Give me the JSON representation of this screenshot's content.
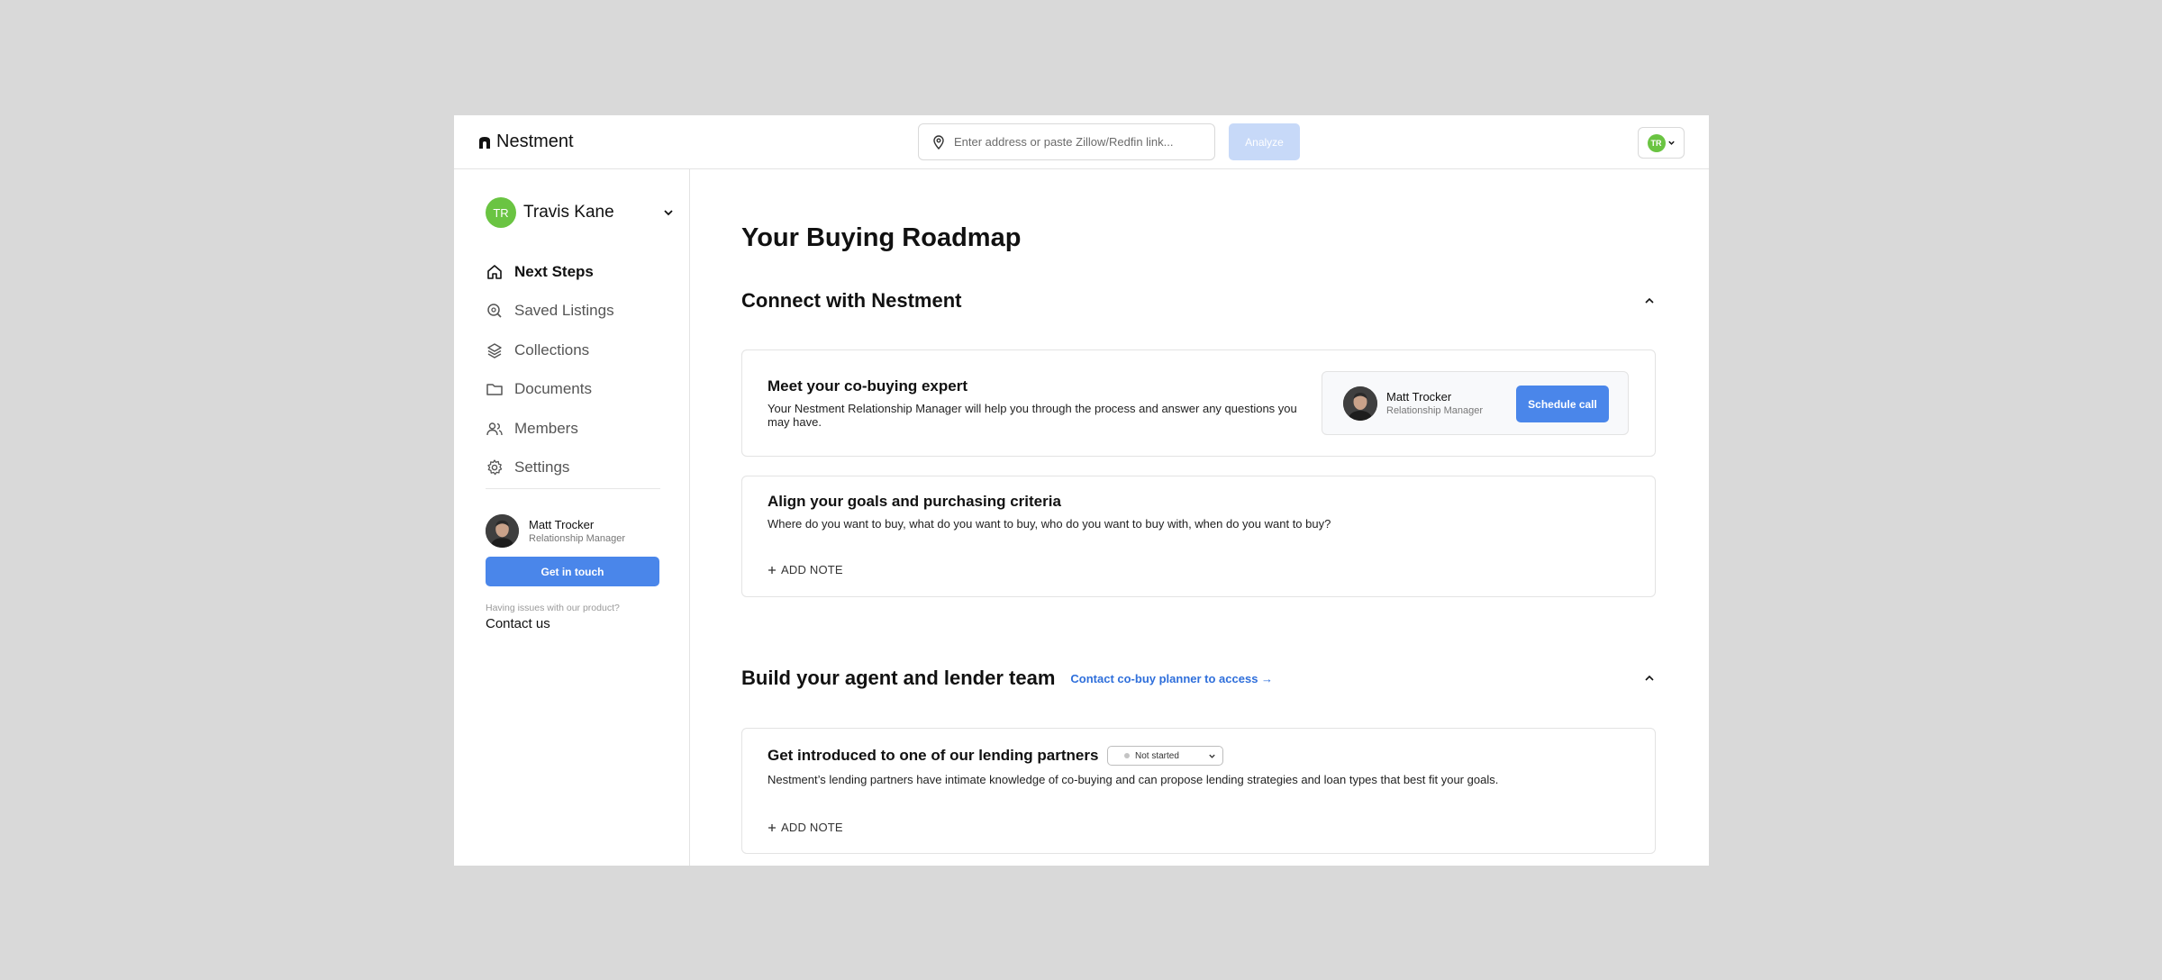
{
  "header": {
    "logo_text": "Nestment",
    "search_placeholder": "Enter address or paste Zillow/Redfin link...",
    "analyze_label": "Analyze",
    "user_initials": "TR"
  },
  "sidebar": {
    "account": {
      "initials": "TR",
      "name": "Travis Kane"
    },
    "items": [
      {
        "label": "Next Steps",
        "icon": "home-icon",
        "active": true
      },
      {
        "label": "Saved Listings",
        "icon": "search-location-icon"
      },
      {
        "label": "Collections",
        "icon": "layers-icon"
      },
      {
        "label": "Documents",
        "icon": "folder-icon"
      },
      {
        "label": "Members",
        "icon": "users-icon"
      },
      {
        "label": "Settings",
        "icon": "gear-icon"
      }
    ],
    "manager": {
      "name": "Matt Trocker",
      "role": "Relationship Manager"
    },
    "get_in_touch_label": "Get in touch",
    "help_text": "Having issues with our product?",
    "contact_label": "Contact us"
  },
  "main": {
    "page_title": "Your Buying Roadmap",
    "sections": [
      {
        "title": "Connect with Nestment",
        "cards": [
          {
            "title": "Meet your co-buying expert",
            "description": "Your Nestment Relationship Manager will help you through the process and answer any questions you may have.",
            "expert": {
              "name": "Matt Trocker",
              "role": "Relationship Manager",
              "button_label": "Schedule call"
            }
          },
          {
            "title": "Align your goals and purchasing criteria",
            "description": "Where do you want to buy, what do you want to buy, who do you want to buy with, when do you want to buy?",
            "add_note_label": "ADD NOTE"
          }
        ]
      },
      {
        "title": "Build your agent and lender team",
        "link_label": "Contact co-buy planner to access →",
        "cards": [
          {
            "title": "Get introduced to one of our lending partners",
            "status": "Not started",
            "description": "Nestment’s lending partners have intimate knowledge of co-buying and can propose lending strategies and loan types that best fit your goals.",
            "add_note_label": "ADD NOTE"
          }
        ]
      }
    ]
  },
  "colors": {
    "accent_blue": "#4a86ea",
    "link_blue": "#2f6fdb",
    "avatar_green": "#6ac442",
    "analyze_disabled": "#c7d9f8"
  }
}
